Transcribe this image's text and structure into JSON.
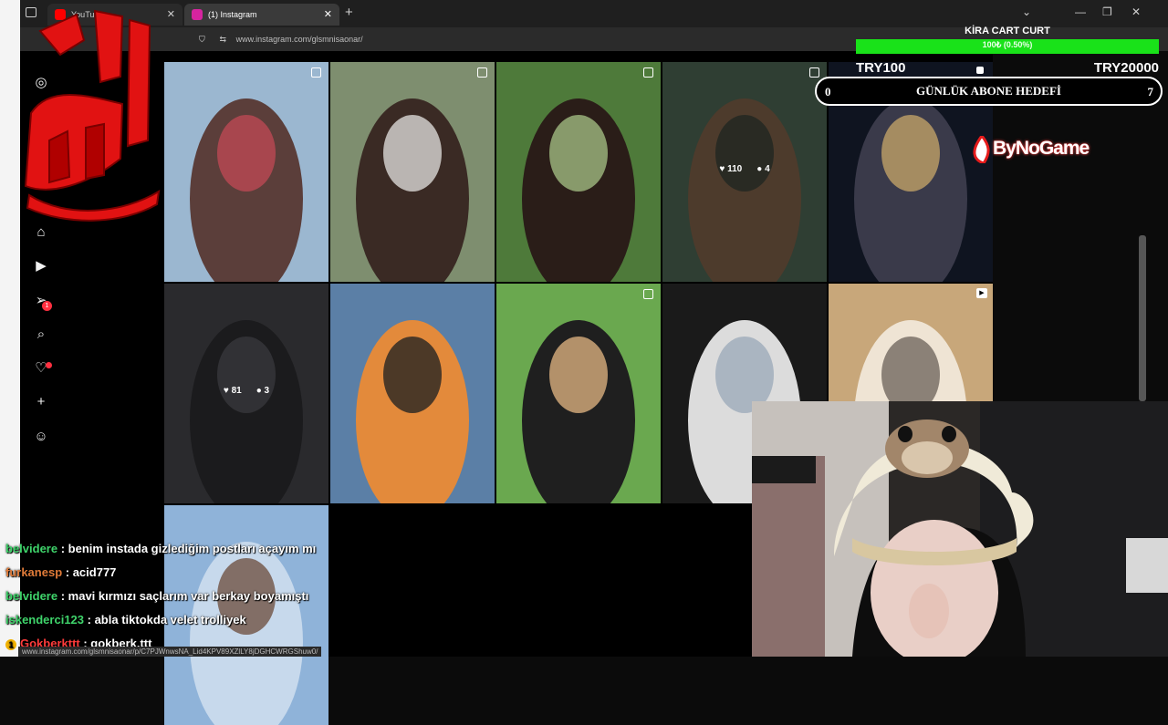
{
  "browser": {
    "tabs": [
      {
        "label": "YouTube",
        "favicon_color": "#ff0000",
        "active": false
      },
      {
        "label": "(1) Instagram",
        "favicon_color": "#d6249f",
        "active": true
      }
    ],
    "url": "www.instagram.com/glsmnisaonar/",
    "status_url": "www.instagram.com/glsmnisaonar/p/C7PJWnwsNA_Lid4KPV89XZlLY8jDGHCWRGShuw0/"
  },
  "instagram": {
    "nav_icons": [
      "instagram-icon",
      "home-icon",
      "reels-icon",
      "messages-icon",
      "search-icon",
      "notifications-icon",
      "create-icon",
      "profile-icon"
    ],
    "messages_badge": "1",
    "posts": [
      {
        "kind": "photo",
        "colors": [
          "#9bb7d0",
          "#5b3e3a",
          "#c24a55"
        ],
        "multi": true
      },
      {
        "kind": "photo",
        "colors": [
          "#7e8e6f",
          "#3a2a24",
          "#e6e4e2"
        ],
        "multi": true
      },
      {
        "kind": "photo",
        "colors": [
          "#4e7a3a",
          "#2a1d18",
          "#a8c487"
        ],
        "multi": true
      },
      {
        "kind": "photo",
        "colors": [
          "#2f3e33",
          "#4d3b2c",
          "#1d2620"
        ],
        "multi": true,
        "likes": "110",
        "comments": "4"
      },
      {
        "kind": "photo",
        "colors": [
          "#0f1420",
          "#3a3a4a",
          "#c9a86a"
        ],
        "multi": false
      },
      {
        "kind": "photo",
        "colors": [
          "#2a2a2d",
          "#1b1b1d",
          "#3a3a3e"
        ],
        "multi": false,
        "likes": "81",
        "comments": "3"
      },
      {
        "kind": "photo",
        "colors": [
          "#5b7fa6",
          "#e38a3b",
          "#1a1d22"
        ],
        "multi": false
      },
      {
        "kind": "photo",
        "colors": [
          "#6aa84f",
          "#1f1f1f",
          "#e5b884"
        ],
        "multi": true
      },
      {
        "kind": "photo",
        "colors": [
          "#1a1a1a",
          "#dcdcdc",
          "#9aa8b8"
        ],
        "multi": false
      },
      {
        "kind": "reel",
        "colors": [
          "#c8a77a",
          "#efe4d4",
          "#6a6058"
        ],
        "multi": false
      },
      {
        "kind": "photo",
        "colors": [
          "#8fb3d9",
          "#c7d9ec",
          "#6b4a3a"
        ],
        "multi": false
      }
    ]
  },
  "overlay": {
    "donation_title": "KİRA CART CURT",
    "donation_percent_text": "100₺ (0.50%)",
    "donation_fraction": 0.005,
    "donation_min": "TRY100",
    "donation_max": "TRY20000",
    "goal_label": "GÜNLÜK ABONE HEDEFİ",
    "goal_current": "0",
    "goal_target": "7",
    "sponsor": "ByNoGame",
    "accent": "#19e219"
  },
  "chat": [
    {
      "user": "belvidere",
      "user_color": "#3fd46b",
      "text": "benim instada gizlediğim postları açayım mı"
    },
    {
      "user": "furkanesp",
      "user_color": "#e07b39",
      "text": "acid777"
    },
    {
      "user": "belvidere",
      "user_color": "#3fd46b",
      "text": "mavi kırmızı saçlarım var berkay boyamıştı"
    },
    {
      "user": "iskenderci123",
      "user_color": "#3fd46b",
      "text": "abla tiktokda velet trolliyek"
    },
    {
      "user": "Gokberkttt",
      "user_color": "#ff3b3b",
      "text": "gokberk.ttt",
      "badge": "1"
    }
  ]
}
